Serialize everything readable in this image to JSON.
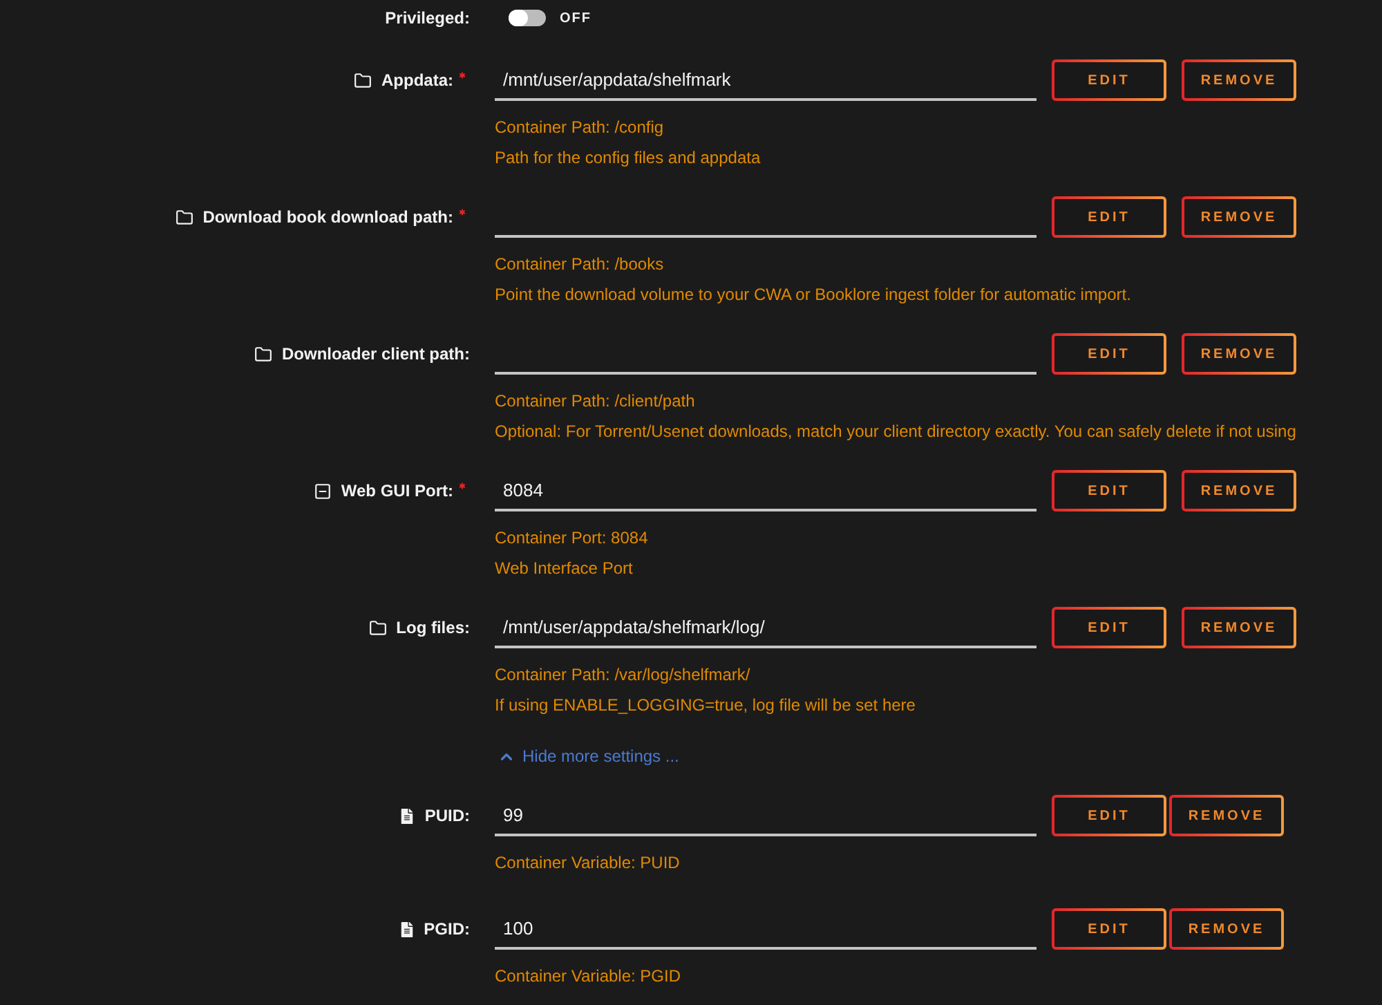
{
  "privileged": {
    "label": "Privileged:",
    "on": false,
    "state_label": "OFF"
  },
  "fields": [
    {
      "kind": "path",
      "label": "Appdata:",
      "required": true,
      "value": "/mnt/user/appdata/shelfmark",
      "container_info": "Container Path: /config",
      "description": "Path for the config files and appdata",
      "edit_button": "EDIT",
      "remove_button": "REMOVE"
    },
    {
      "kind": "path",
      "label": "Download book download path:",
      "required": true,
      "container_info": "Container Path: /books",
      "description": "Point the download volume to your CWA or Booklore ingest folder for automatic import.",
      "edit_button": "EDIT",
      "remove_button": "REMOVE"
    },
    {
      "kind": "path",
      "label": "Downloader client path:",
      "required": false,
      "container_info": "Container Path: /client/path",
      "description": "Optional: For Torrent/Usenet downloads, match your client directory exactly. You can safely delete if not using",
      "edit_button": "EDIT",
      "remove_button": "REMOVE"
    },
    {
      "kind": "port",
      "label": "Web GUI Port:",
      "required": true,
      "value": "8084",
      "container_info": "Container Port: 8084",
      "description": "Web Interface Port",
      "edit_button": "EDIT",
      "remove_button": "REMOVE"
    },
    {
      "kind": "path",
      "label": "Log files:",
      "required": false,
      "value": "/mnt/user/appdata/shelfmark/log/",
      "container_info": "Container Path: /var/log/shelfmark/",
      "description": "If using ENABLE_LOGGING=true, log file will be set here",
      "edit_button": "EDIT",
      "remove_button": "REMOVE"
    }
  ],
  "settings_toggle": {
    "label": "Hide more settings ...",
    "expanded": true
  },
  "more_fields": [
    {
      "kind": "variable",
      "label": "PUID:",
      "required": false,
      "value": "99",
      "container_info": "Container Variable: PUID",
      "edit_button": "EDIT",
      "remove_button": "REMOVE"
    },
    {
      "kind": "variable",
      "label": "PGID:",
      "required": false,
      "value": "100",
      "container_info": "Container Variable: PGID",
      "edit_button": "EDIT",
      "remove_button": "REMOVE"
    }
  ]
}
